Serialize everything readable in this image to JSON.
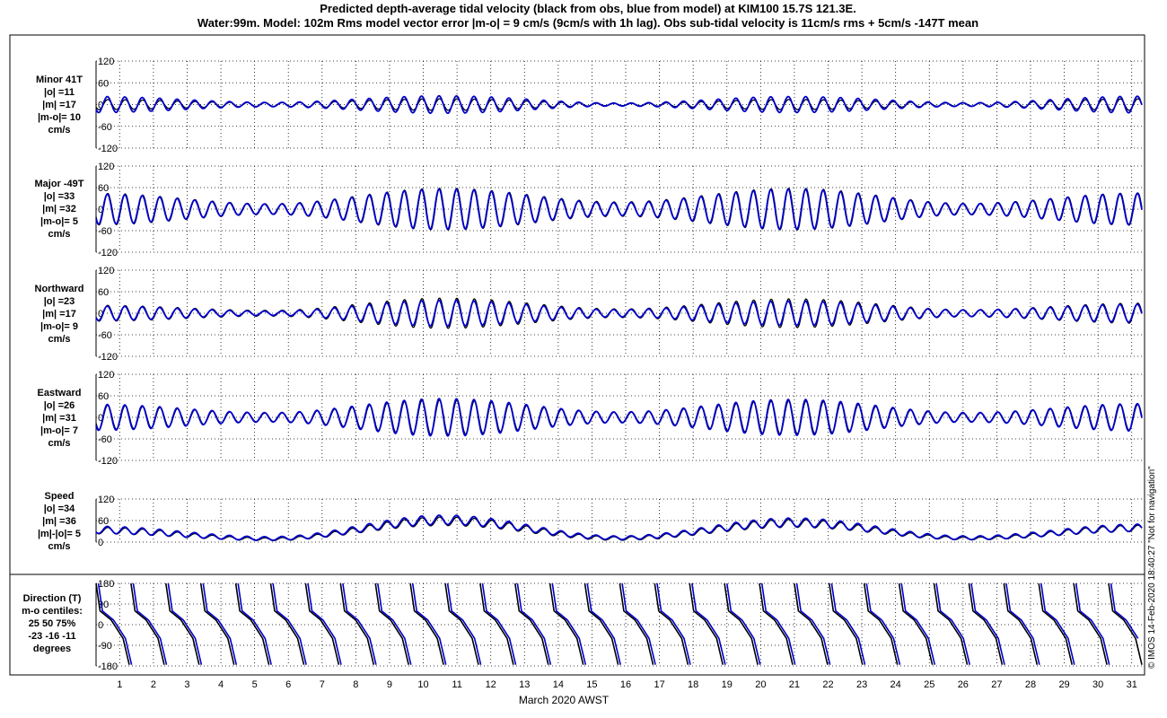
{
  "title_lines": [
    "Predicted depth-average tidal velocity (black from obs, blue from model) at KIM100 15.7S 121.3E.",
    "Water:99m. Model: 102m  Rms model vector error |m-o| = 9 cm/s (9cm/s with 1h lag). Obs sub-tidal velocity is 11cm/s rms + 5cm/s -147T mean"
  ],
  "xlabel": "March 2020 AWST",
  "credit": "© IMOS 14-Feb-2020 18:40:27  \"Not for navigation\"",
  "colors": {
    "obs": "#000000",
    "model": "#0000cc"
  },
  "chart_data": {
    "type": "line",
    "x_tick_labels": [
      "1",
      "2",
      "3",
      "4",
      "5",
      "6",
      "7",
      "8",
      "9",
      "10",
      "11",
      "12",
      "13",
      "14",
      "15",
      "16",
      "17",
      "18",
      "19",
      "20",
      "21",
      "22",
      "23",
      "24",
      "25",
      "26",
      "27",
      "28",
      "29",
      "30",
      "31"
    ],
    "x_range_days": [
      0.3,
      31.3
    ],
    "grid": true,
    "panels": [
      {
        "label_lines": [
          "Minor 41T",
          "|o| =11",
          "|m| =17",
          "|m-o|= 10",
          "cm/s"
        ],
        "ylim": [
          -120,
          120
        ],
        "yticks": [
          "120",
          "60",
          "0",
          "-60",
          "-120"
        ],
        "series": [
          {
            "key": "obs",
            "amplitude": [
              14,
              5,
              16,
              3,
              14,
              4,
              16
            ],
            "offset": 0
          },
          {
            "key": "model",
            "amplitude": [
              22,
              6,
              24,
              4,
              22,
              5,
              23
            ],
            "offset": 0
          }
        ]
      },
      {
        "label_lines": [
          "Major -49T",
          "|o| =33",
          "|m| =32",
          "|m-o|= 5",
          "cm/s"
        ],
        "ylim": [
          -120,
          120
        ],
        "yticks": [
          "120",
          "60",
          "0",
          "-60",
          "-120"
        ],
        "series": [
          {
            "key": "obs",
            "amplitude": [
              44,
              15,
              58,
              20,
              58,
              16,
              45
            ],
            "offset": 0
          },
          {
            "key": "model",
            "amplitude": [
              42,
              14,
              56,
              18,
              56,
              15,
              44
            ],
            "offset": 0
          }
        ]
      },
      {
        "label_lines": [
          "Northward",
          "|o| =23",
          "|m| =17",
          "|m-o|= 9",
          "cm/s"
        ],
        "ylim": [
          -120,
          120
        ],
        "yticks": [
          "120",
          "60",
          "0",
          "-60",
          "-120"
        ],
        "series": [
          {
            "key": "obs",
            "amplitude": [
              22,
              8,
              42,
              12,
              40,
              10,
              28
            ],
            "offset": 0
          },
          {
            "key": "model",
            "amplitude": [
              20,
              6,
              36,
              10,
              34,
              9,
              25
            ],
            "offset": 0
          }
        ]
      },
      {
        "label_lines": [
          "Eastward",
          "|o| =26",
          "|m| =31",
          "|m-o|= 7",
          "cm/s"
        ],
        "ylim": [
          -120,
          120
        ],
        "yticks": [
          "120",
          "60",
          "0",
          "-60",
          "-120"
        ],
        "series": [
          {
            "key": "obs",
            "amplitude": [
              34,
              12,
              48,
              14,
              46,
              12,
              36
            ],
            "offset": 0
          },
          {
            "key": "model",
            "amplitude": [
              36,
              13,
              52,
              15,
              50,
              13,
              38
            ],
            "offset": 0
          }
        ]
      },
      {
        "label_lines": [
          "Speed",
          "|o| =34",
          "|m| =36",
          "|m|-|o|= 5",
          "cm/s"
        ],
        "ylim": [
          0,
          120
        ],
        "yticks": [
          "120",
          "60",
          "0"
        ],
        "series": [
          {
            "key": "obs",
            "amplitude": [
              9,
              4,
              12,
              5,
              11,
              4,
              9
            ],
            "offset": [
              32,
              8,
              58,
              10,
              52,
              10,
              38
            ]
          },
          {
            "key": "model",
            "amplitude": [
              10,
              5,
              13,
              5,
              12,
              5,
              10
            ],
            "offset": [
              34,
              10,
              62,
              12,
              55,
              12,
              40
            ]
          }
        ]
      },
      {
        "label_lines": [
          "Direction (T)",
          "m-o centiles:",
          "25  50  75%",
          "-23 -16 -11",
          "degrees"
        ],
        "ylim": [
          -180,
          180
        ],
        "yticks": [
          "180",
          "90",
          "0",
          "-90",
          "-180"
        ],
        "type": "sawtooth"
      }
    ]
  }
}
